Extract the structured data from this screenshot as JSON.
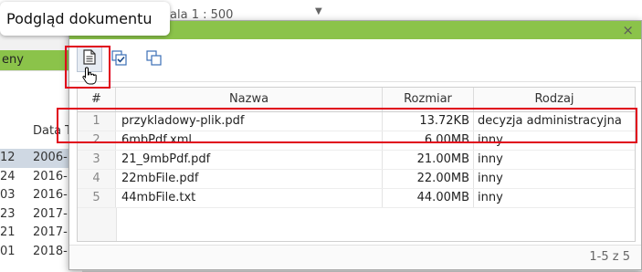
{
  "background": {
    "scale_text": "1 : 500",
    "scale_prefix": "ala",
    "green_label": "eny",
    "date_header": "Data T",
    "ids": [
      "12",
      "24",
      "03",
      "23",
      "21",
      "01"
    ],
    "dates": [
      "2006-",
      "2016-",
      "2016-",
      "2017-",
      "2017-",
      "2018-"
    ]
  },
  "tooltip": {
    "text": "Podgląd dokumentu"
  },
  "modal": {
    "close_symbol": "×",
    "toolbar": {
      "preview_icon": "document-preview-icon",
      "select_icon": "checkbox-select-icon",
      "copy_icon": "copy-windows-icon"
    },
    "table": {
      "headers": {
        "num": "#",
        "name": "Nazwa",
        "size": "Rozmiar",
        "type": "Rodzaj"
      },
      "rows": [
        {
          "num": "1",
          "name": "przykladowy-plik.pdf",
          "size": "13.72KB",
          "type": "decyzja administracyjna"
        },
        {
          "num": "2",
          "name": "6mbPdf.xml",
          "size": "6.00MB",
          "type": "inny"
        },
        {
          "num": "3",
          "name": "21_9mbPdf.pdf",
          "size": "21.00MB",
          "type": "inny"
        },
        {
          "num": "4",
          "name": "22mbFile.pdf",
          "size": "22.00MB",
          "type": "inny"
        },
        {
          "num": "5",
          "name": "44mbFile.txt",
          "size": "44.00MB",
          "type": "inny"
        }
      ]
    },
    "pager": "1-5 z 5"
  },
  "colors": {
    "accent_green": "#8bc34a",
    "highlight_red": "#e0001b"
  }
}
